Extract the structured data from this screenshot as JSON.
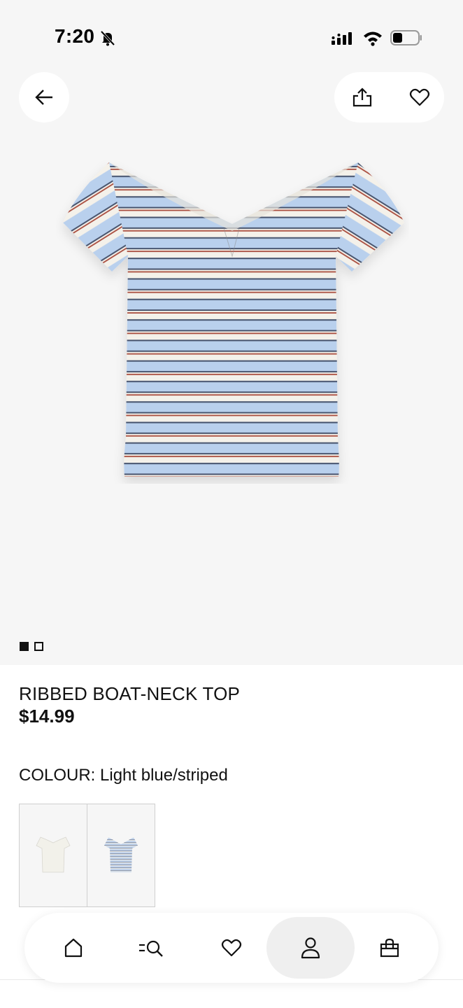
{
  "status_bar": {
    "time": "7:20",
    "icons": [
      "bell-slash-icon",
      "cellular-signal-icon",
      "wifi-icon",
      "battery-icon"
    ]
  },
  "top_actions": {
    "back": "arrow-left-icon",
    "share": "share-icon",
    "favorite": "heart-icon"
  },
  "gallery": {
    "image": "striped-boat-neck-top",
    "image_count": 2,
    "current_index": 1,
    "stripe_colors": {
      "blue": "#b7cfec",
      "cream": "#f4f1ea",
      "red": "#a84b3c",
      "navy": "#44516c"
    }
  },
  "product": {
    "title": "RIBBED BOAT-NECK TOP",
    "price": "$14.99",
    "colour_label": "COLOUR:",
    "colour_value": "Light blue/striped"
  },
  "swatches": [
    {
      "color": "white",
      "selected": false
    },
    {
      "color": "light-blue-striped",
      "selected": true
    }
  ],
  "bottom_nav": {
    "items": [
      {
        "name": "home",
        "icon": "home-icon",
        "active": false
      },
      {
        "name": "search",
        "icon": "search-icon",
        "active": false
      },
      {
        "name": "favourites",
        "icon": "heart-icon",
        "active": false
      },
      {
        "name": "account",
        "icon": "person-icon",
        "active": true
      },
      {
        "name": "bag",
        "icon": "shopping-bag-icon",
        "active": false
      }
    ]
  },
  "colors": {
    "gallery_bg": "#f6f6f6",
    "text": "#111111",
    "active_nav_bg": "#efefef"
  }
}
